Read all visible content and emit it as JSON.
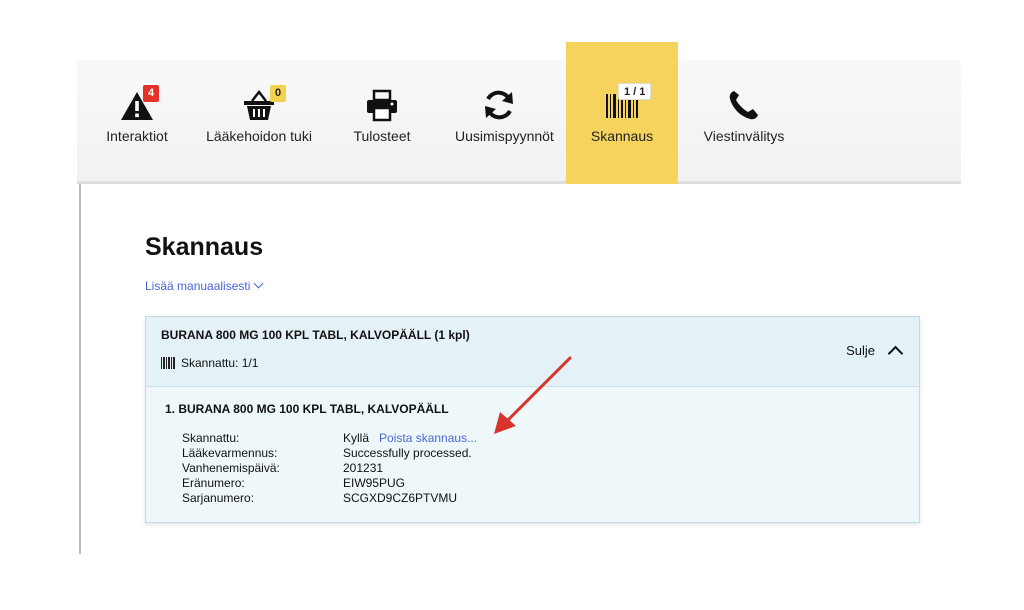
{
  "toolbar": {
    "items": [
      {
        "label": "Interaktiot",
        "badge": "4",
        "icon": "warning-triangle-icon"
      },
      {
        "label": "Lääkehoidon tuki",
        "badge": "0",
        "icon": "basket-icon"
      },
      {
        "label": "Tulosteet",
        "icon": "printer-icon"
      },
      {
        "label": "Uusimispyynnöt",
        "icon": "refresh-icon"
      },
      {
        "label": "Skannaus",
        "badge": "1 / 1",
        "icon": "barcode-icon",
        "active": true
      },
      {
        "label": "Viestinvälitys",
        "icon": "phone-icon"
      }
    ]
  },
  "page": {
    "title": "Skannaus",
    "add_manual": "Lisää manuaalisesti"
  },
  "panel": {
    "product_name": "BURANA 800 MG 100 KPL TABL, KALVOPÄÄLL (1 kpl)",
    "scanned_summary": "Skannattu: 1/1",
    "close_label": "Sulje",
    "item_title": "1. BURANA 800 MG 100 KPL TABL, KALVOPÄÄLL",
    "details": [
      {
        "key": "Skannattu:",
        "value": "Kyllä"
      },
      {
        "key": "Lääkevarmennus:",
        "value": "Successfully processed."
      },
      {
        "key": "Vanhenemispäivä:",
        "value": "201231"
      },
      {
        "key": "Eränumero:",
        "value": "EIW95PUG"
      },
      {
        "key": "Sarjanumero:",
        "value": "SCGXD9CZ6PTVMU"
      }
    ],
    "remove_scan": "Poista skannaus..."
  },
  "colors": {
    "active_tab": "#f5d35c",
    "link": "#4a66d8",
    "badge_red": "#e5312a",
    "badge_yellow": "#f2d24e",
    "arrow": "#d9342b",
    "panel_bg": "#eef8fb"
  }
}
